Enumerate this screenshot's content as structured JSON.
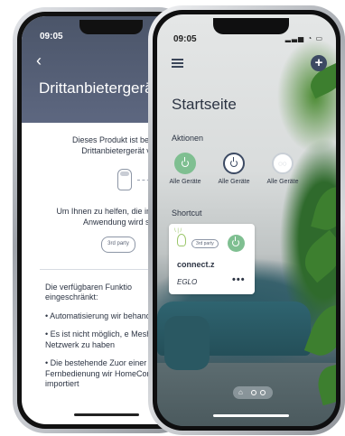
{
  "back_screen": {
    "time": "09:05",
    "title": "Drittanbietergeräte",
    "intro": "Dieses Produkt ist bereits Drittanbietergerät ve",
    "info": "Um Ihnen zu helfen, die innerhalb de Anwendung wird sie g",
    "tag": "3rd party",
    "features_title": "Die verfügbaren Funktio eingeschränkt:",
    "features": [
      "• Automatisierung wir behandelt",
      "• Es ist nicht möglich, e Mesh-Netzwerk zu haben",
      "• Die bestehende Zuor einer Fernbedienung wir HomeControl importiert"
    ]
  },
  "front_screen": {
    "time": "09:05",
    "page_title": "Startseite",
    "actions_label": "Aktionen",
    "actions": [
      {
        "label": "Alle Geräte",
        "icon": "power-icon",
        "state": "on"
      },
      {
        "label": "Alle Geräte",
        "icon": "power-icon",
        "state": "off"
      },
      {
        "label": "Alle Geräte",
        "icon": "bulbs-icon",
        "state": "group"
      }
    ],
    "shortcut_label": "Shortcut",
    "shortcut": {
      "tag": "3rd party",
      "name": "connect.z",
      "brand": "EGLO",
      "more": "•••"
    },
    "pager_pages": 3,
    "pager_active": 1
  },
  "colors": {
    "accent_green": "#7fbf91",
    "header_dark": "#4b5569",
    "text_dark": "#2c3443"
  }
}
